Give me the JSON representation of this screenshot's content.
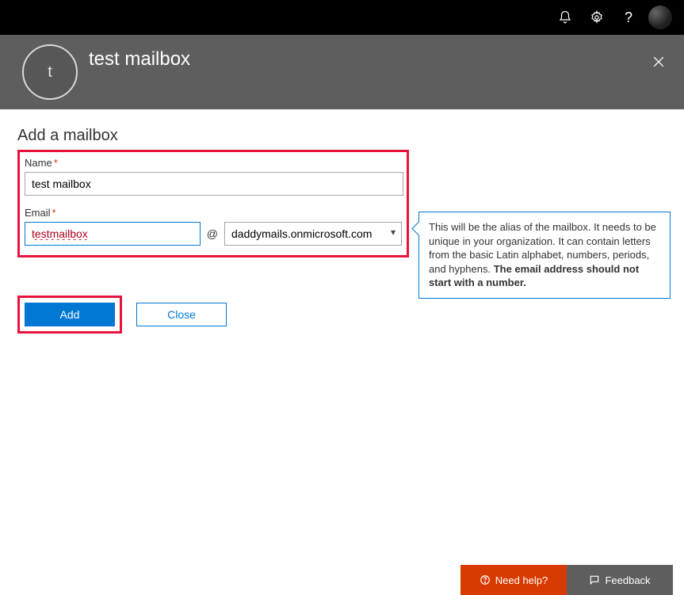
{
  "topbar": {
    "icons": {
      "bell": "bell-icon",
      "gear": "gear-icon",
      "help": "help-icon",
      "avatar": "user-avatar"
    }
  },
  "header": {
    "avatar_letter": "t",
    "title": "test mailbox",
    "close_label": "Close"
  },
  "page": {
    "heading": "Add a mailbox"
  },
  "form": {
    "name_label": "Name",
    "name_value": "test mailbox",
    "email_label": "Email",
    "email_alias_value": "testmailbox",
    "at": "@",
    "domain_selected": "daddymails.onmicrosoft.com"
  },
  "callout": {
    "text_plain": "This will be the alias of the mailbox. It needs to be unique in your organization. It can contain letters from the basic Latin alphabet, numbers, periods, and hyphens. ",
    "text_bold": "The email address should not start with a number."
  },
  "buttons": {
    "add": "Add",
    "close": "Close"
  },
  "footer": {
    "need_help": "Need help?",
    "feedback": "Feedback"
  }
}
